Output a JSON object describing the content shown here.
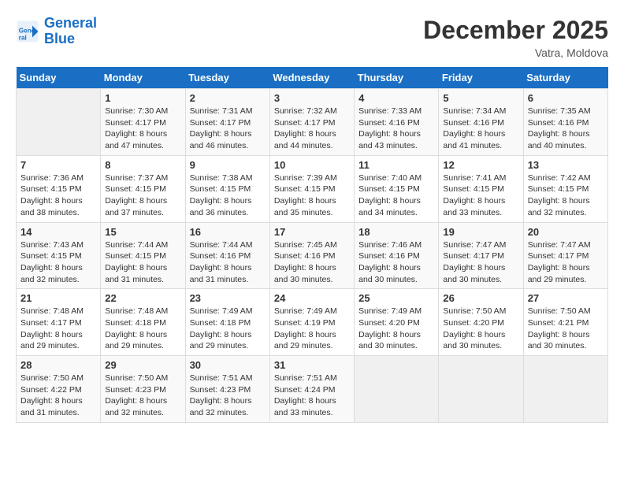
{
  "header": {
    "logo_line1": "General",
    "logo_line2": "Blue",
    "month_year": "December 2025",
    "location": "Vatra, Moldova"
  },
  "weekdays": [
    "Sunday",
    "Monday",
    "Tuesday",
    "Wednesday",
    "Thursday",
    "Friday",
    "Saturday"
  ],
  "weeks": [
    [
      {
        "day": "",
        "sunrise": "",
        "sunset": "",
        "daylight": ""
      },
      {
        "day": "1",
        "sunrise": "7:30 AM",
        "sunset": "4:17 PM",
        "daylight": "8 hours and 47 minutes."
      },
      {
        "day": "2",
        "sunrise": "7:31 AM",
        "sunset": "4:17 PM",
        "daylight": "8 hours and 46 minutes."
      },
      {
        "day": "3",
        "sunrise": "7:32 AM",
        "sunset": "4:17 PM",
        "daylight": "8 hours and 44 minutes."
      },
      {
        "day": "4",
        "sunrise": "7:33 AM",
        "sunset": "4:16 PM",
        "daylight": "8 hours and 43 minutes."
      },
      {
        "day": "5",
        "sunrise": "7:34 AM",
        "sunset": "4:16 PM",
        "daylight": "8 hours and 41 minutes."
      },
      {
        "day": "6",
        "sunrise": "7:35 AM",
        "sunset": "4:16 PM",
        "daylight": "8 hours and 40 minutes."
      }
    ],
    [
      {
        "day": "7",
        "sunrise": "7:36 AM",
        "sunset": "4:15 PM",
        "daylight": "8 hours and 38 minutes."
      },
      {
        "day": "8",
        "sunrise": "7:37 AM",
        "sunset": "4:15 PM",
        "daylight": "8 hours and 37 minutes."
      },
      {
        "day": "9",
        "sunrise": "7:38 AM",
        "sunset": "4:15 PM",
        "daylight": "8 hours and 36 minutes."
      },
      {
        "day": "10",
        "sunrise": "7:39 AM",
        "sunset": "4:15 PM",
        "daylight": "8 hours and 35 minutes."
      },
      {
        "day": "11",
        "sunrise": "7:40 AM",
        "sunset": "4:15 PM",
        "daylight": "8 hours and 34 minutes."
      },
      {
        "day": "12",
        "sunrise": "7:41 AM",
        "sunset": "4:15 PM",
        "daylight": "8 hours and 33 minutes."
      },
      {
        "day": "13",
        "sunrise": "7:42 AM",
        "sunset": "4:15 PM",
        "daylight": "8 hours and 32 minutes."
      }
    ],
    [
      {
        "day": "14",
        "sunrise": "7:43 AM",
        "sunset": "4:15 PM",
        "daylight": "8 hours and 32 minutes."
      },
      {
        "day": "15",
        "sunrise": "7:44 AM",
        "sunset": "4:15 PM",
        "daylight": "8 hours and 31 minutes."
      },
      {
        "day": "16",
        "sunrise": "7:44 AM",
        "sunset": "4:16 PM",
        "daylight": "8 hours and 31 minutes."
      },
      {
        "day": "17",
        "sunrise": "7:45 AM",
        "sunset": "4:16 PM",
        "daylight": "8 hours and 30 minutes."
      },
      {
        "day": "18",
        "sunrise": "7:46 AM",
        "sunset": "4:16 PM",
        "daylight": "8 hours and 30 minutes."
      },
      {
        "day": "19",
        "sunrise": "7:47 AM",
        "sunset": "4:17 PM",
        "daylight": "8 hours and 30 minutes."
      },
      {
        "day": "20",
        "sunrise": "7:47 AM",
        "sunset": "4:17 PM",
        "daylight": "8 hours and 29 minutes."
      }
    ],
    [
      {
        "day": "21",
        "sunrise": "7:48 AM",
        "sunset": "4:17 PM",
        "daylight": "8 hours and 29 minutes."
      },
      {
        "day": "22",
        "sunrise": "7:48 AM",
        "sunset": "4:18 PM",
        "daylight": "8 hours and 29 minutes."
      },
      {
        "day": "23",
        "sunrise": "7:49 AM",
        "sunset": "4:18 PM",
        "daylight": "8 hours and 29 minutes."
      },
      {
        "day": "24",
        "sunrise": "7:49 AM",
        "sunset": "4:19 PM",
        "daylight": "8 hours and 29 minutes."
      },
      {
        "day": "25",
        "sunrise": "7:49 AM",
        "sunset": "4:20 PM",
        "daylight": "8 hours and 30 minutes."
      },
      {
        "day": "26",
        "sunrise": "7:50 AM",
        "sunset": "4:20 PM",
        "daylight": "8 hours and 30 minutes."
      },
      {
        "day": "27",
        "sunrise": "7:50 AM",
        "sunset": "4:21 PM",
        "daylight": "8 hours and 30 minutes."
      }
    ],
    [
      {
        "day": "28",
        "sunrise": "7:50 AM",
        "sunset": "4:22 PM",
        "daylight": "8 hours and 31 minutes."
      },
      {
        "day": "29",
        "sunrise": "7:50 AM",
        "sunset": "4:23 PM",
        "daylight": "8 hours and 32 minutes."
      },
      {
        "day": "30",
        "sunrise": "7:51 AM",
        "sunset": "4:23 PM",
        "daylight": "8 hours and 32 minutes."
      },
      {
        "day": "31",
        "sunrise": "7:51 AM",
        "sunset": "4:24 PM",
        "daylight": "8 hours and 33 minutes."
      },
      {
        "day": "",
        "sunrise": "",
        "sunset": "",
        "daylight": ""
      },
      {
        "day": "",
        "sunrise": "",
        "sunset": "",
        "daylight": ""
      },
      {
        "day": "",
        "sunrise": "",
        "sunset": "",
        "daylight": ""
      }
    ]
  ]
}
